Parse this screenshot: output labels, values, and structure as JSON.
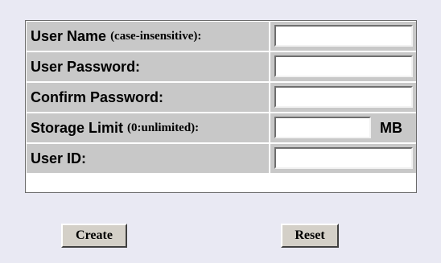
{
  "form": {
    "rows": [
      {
        "label": "User Name",
        "hint": "(case-insensitive):",
        "value": ""
      },
      {
        "label": "User Password:",
        "hint": "",
        "value": ""
      },
      {
        "label": "Confirm Password:",
        "hint": "",
        "value": ""
      },
      {
        "label": "Storage Limit",
        "hint": "(0:unlimited):",
        "value": "",
        "unit": "MB"
      },
      {
        "label": "User ID:",
        "hint": "",
        "value": ""
      }
    ]
  },
  "buttons": {
    "create_label": "Create",
    "reset_label": "Reset"
  },
  "colors": {
    "page_background": "#e9e9f3",
    "cell_background": "#c8c8c8",
    "button_face": "#d4d0c8"
  }
}
